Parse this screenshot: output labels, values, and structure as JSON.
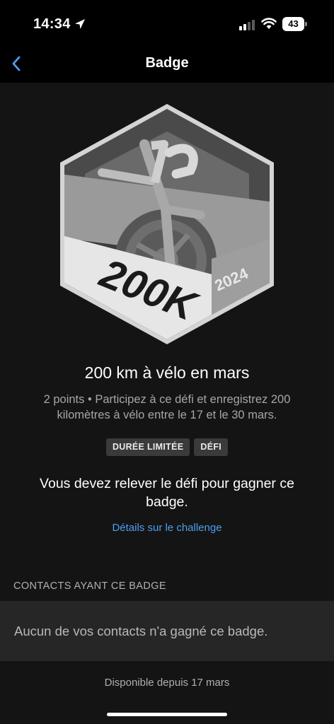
{
  "status_bar": {
    "time": "14:34",
    "battery": "43"
  },
  "nav": {
    "title": "Badge"
  },
  "badge": {
    "graphic_text": "200K",
    "graphic_year": "2024",
    "title": "200 km à vélo en mars",
    "description": "2 points • Participez à ce défi et enregistrez 200 kilomètres à vélo entre le 17 et le 30 mars.",
    "tags": [
      "DURÉE LIMITÉE",
      "DÉFI"
    ],
    "requirement": "Vous devez relever le défi pour gagner ce badge.",
    "challenge_link": "Détails sur le challenge"
  },
  "contacts": {
    "header": "CONTACTS AYANT CE BADGE",
    "empty_message": "Aucun de vos contacts n'a gagné ce badge."
  },
  "footer": {
    "available": "Disponible depuis 17 mars"
  },
  "colors": {
    "background": "#141414",
    "top_bar": "#000000",
    "card": "#262626",
    "link": "#4e9ef0",
    "tag_bg": "#3a3a3a"
  }
}
